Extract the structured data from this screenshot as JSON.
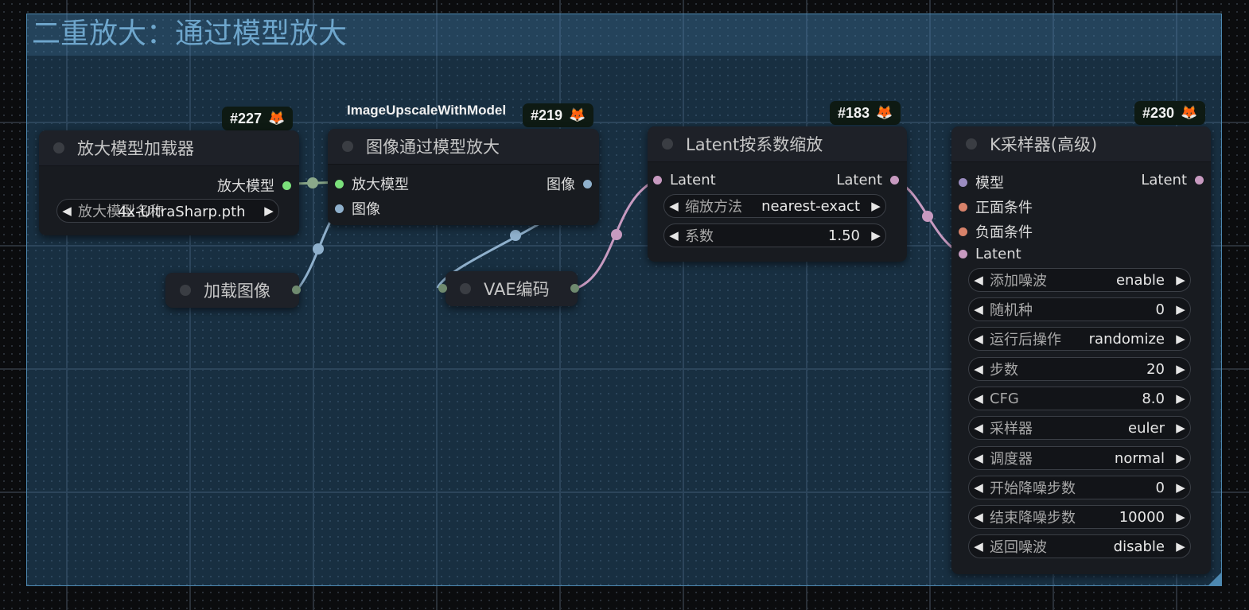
{
  "group": {
    "title": "二重放大：通过模型放大"
  },
  "colors": {
    "model_slot": "#7be07b",
    "image_slot": "#8fb0cc",
    "latent_slot": "#c79ac0",
    "positive_slot": "#d8826a",
    "negative_slot": "#d8826a",
    "sampler_model_slot": "#9b8cc0"
  },
  "nodes": {
    "upscale_loader": {
      "id": "#227",
      "title": "放大模型加载器",
      "output": "放大模型",
      "widget_label": "放大模型名称",
      "widget_value": "4x-UltraSharp.pth"
    },
    "image_upscale": {
      "id": "#219",
      "type_label": "ImageUpscaleWithModel",
      "title": "图像通过模型放大",
      "inputs": [
        "放大模型",
        "图像"
      ],
      "output": "图像"
    },
    "load_image": {
      "title": "加载图像"
    },
    "vae_encode": {
      "title": "VAE编码"
    },
    "latent_scale": {
      "id": "#183",
      "title": "Latent按系数缩放",
      "input": "Latent",
      "output": "Latent",
      "widgets": [
        {
          "label": "缩放方法",
          "value": "nearest-exact"
        },
        {
          "label": "系数",
          "value": "1.50"
        }
      ]
    },
    "ksampler": {
      "id": "#230",
      "title": "K采样器(高级)",
      "inputs": [
        "模型",
        "正面条件",
        "负面条件",
        "Latent"
      ],
      "output": "Latent",
      "widgets": [
        {
          "label": "添加噪波",
          "value": "enable"
        },
        {
          "label": "随机种",
          "value": "0"
        },
        {
          "label": "运行后操作",
          "value": "randomize"
        },
        {
          "label": "步数",
          "value": "20"
        },
        {
          "label": "CFG",
          "value": "8.0"
        },
        {
          "label": "采样器",
          "value": "euler"
        },
        {
          "label": "调度器",
          "value": "normal"
        },
        {
          "label": "开始降噪步数",
          "value": "0"
        },
        {
          "label": "结束降噪步数",
          "value": "10000"
        },
        {
          "label": "返回噪波",
          "value": "disable"
        }
      ]
    }
  },
  "icons": {
    "badge": "fox-icon",
    "left": "arrow-left-icon",
    "right": "arrow-right-icon"
  }
}
